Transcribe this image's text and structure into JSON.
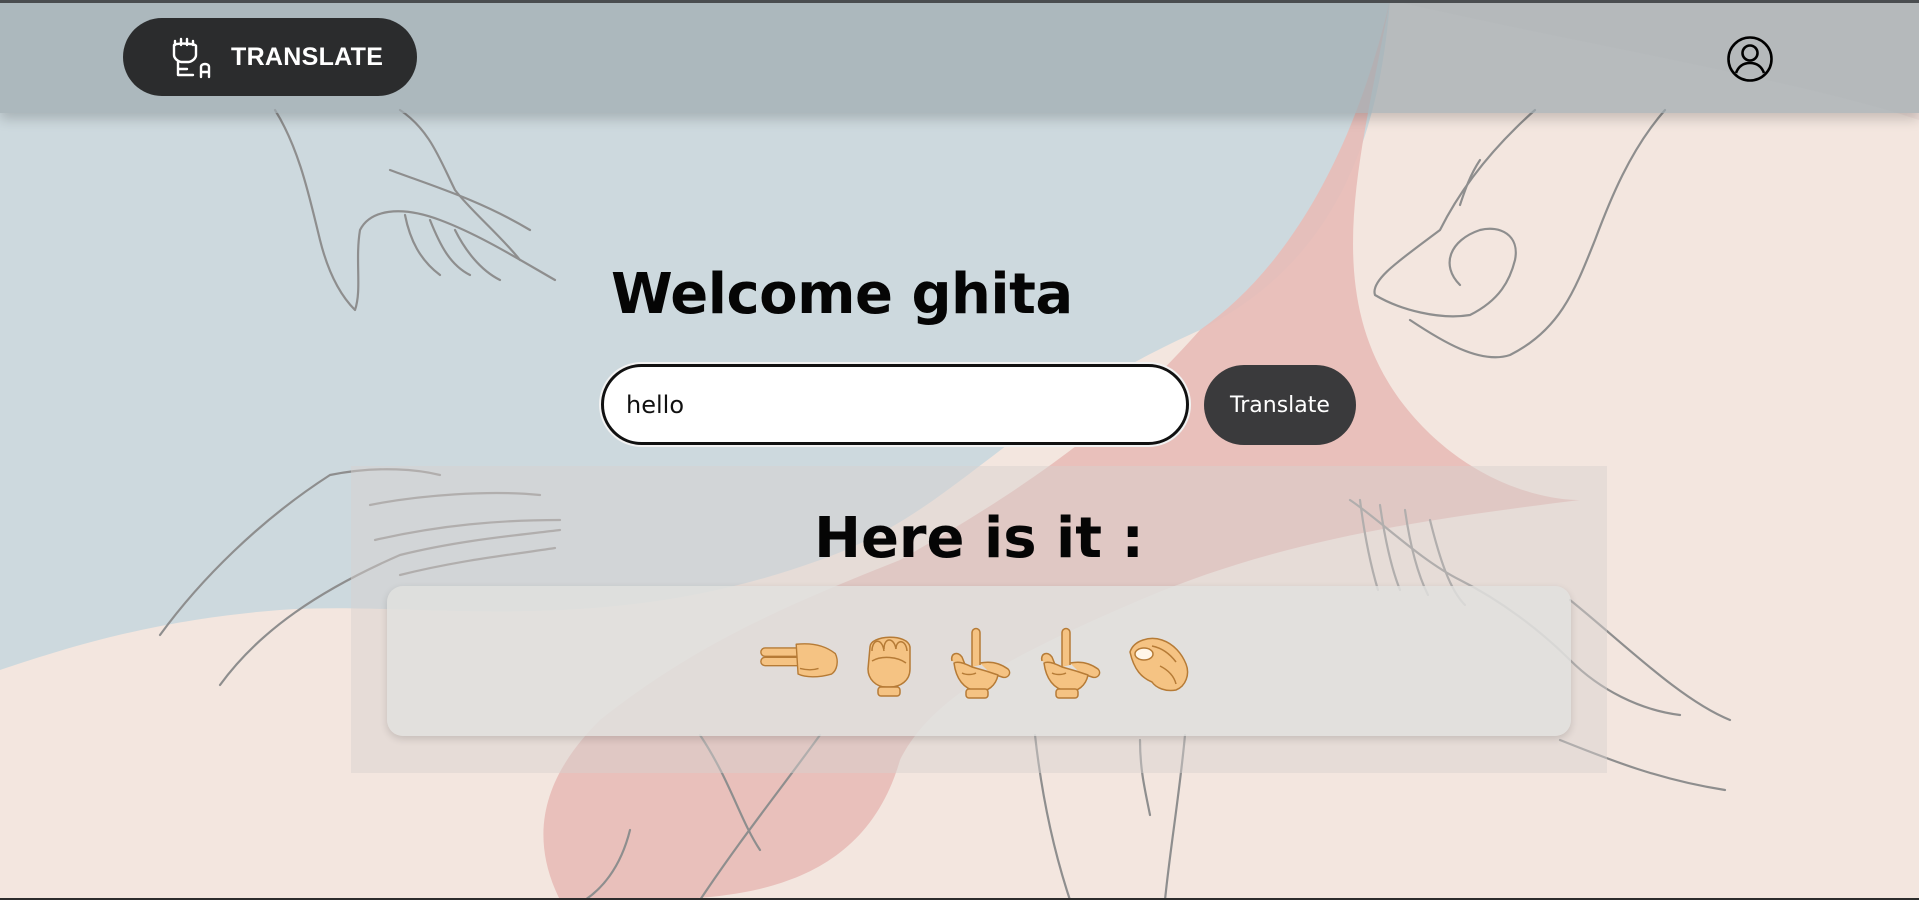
{
  "app": {
    "brand_label": "TRANSLATE",
    "brand_icon": "sign-language-fist-icon",
    "profile_icon": "user-account-icon"
  },
  "welcome": {
    "title": "Welcome ghita"
  },
  "search": {
    "value": "hello"
  },
  "translate_button": {
    "label": "Translate"
  },
  "result": {
    "title": "Here is it :",
    "signs": [
      {
        "letter": "h",
        "icon": "hand-h-sign-icon"
      },
      {
        "letter": "e",
        "icon": "hand-e-sign-icon"
      },
      {
        "letter": "l",
        "icon": "hand-l-sign-icon"
      },
      {
        "letter": "l",
        "icon": "hand-l-sign-icon"
      },
      {
        "letter": "o",
        "icon": "hand-o-sign-icon"
      }
    ]
  },
  "colors": {
    "accent_dark": "#2b2c2d",
    "button": "#3a3a3c",
    "background_blue": "#cdd9de",
    "background_pink": "#f3e6df",
    "background_red": "#e8bbb7"
  }
}
